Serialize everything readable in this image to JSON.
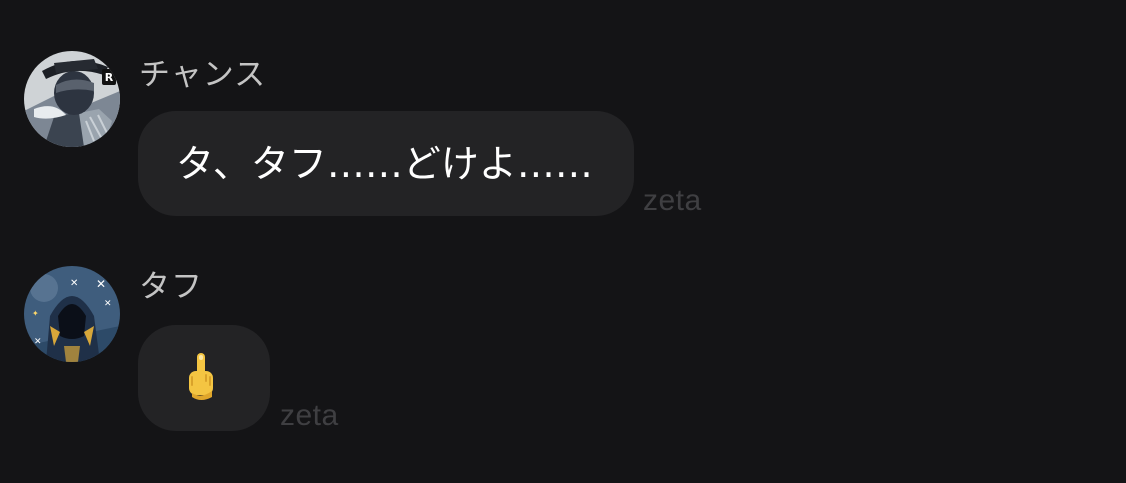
{
  "messages": [
    {
      "sender": "チャンス",
      "text": "タ、タフ……どけよ……",
      "watermark": "zeta",
      "avatar_icon": "character-avatar-icon"
    },
    {
      "sender": "タフ",
      "emoji": "🖕",
      "emoji_icon": "middle-finger-emoji-icon",
      "watermark": "zeta",
      "avatar_icon": "hooded-character-avatar-icon"
    }
  ],
  "colors": {
    "background": "#141416",
    "bubble": "#232325",
    "sender_text": "#c4c4c4",
    "message_text": "#ffffff",
    "watermark": "#3f3f42"
  }
}
